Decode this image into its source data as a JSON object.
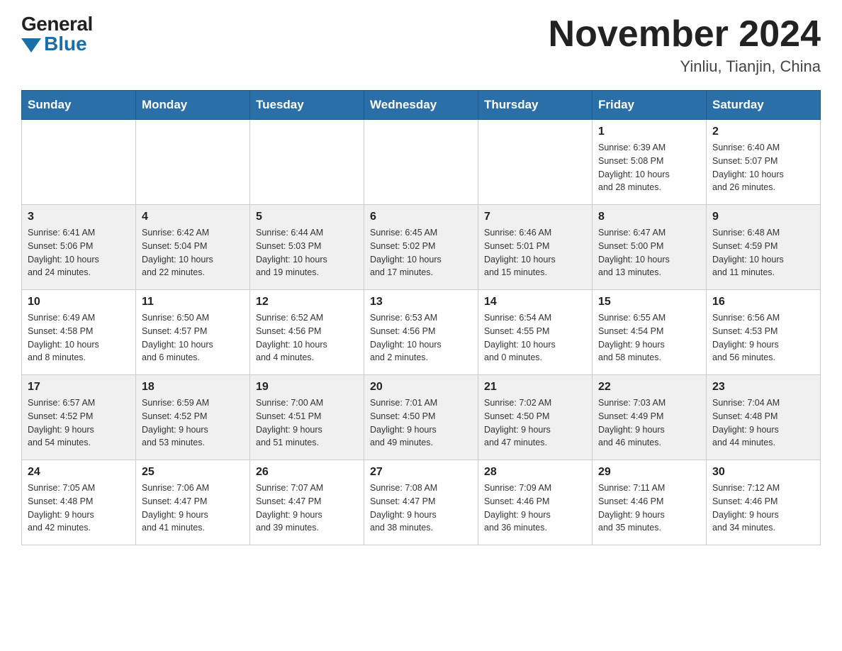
{
  "header": {
    "logo": {
      "general": "General",
      "blue": "Blue"
    },
    "title": "November 2024",
    "location": "Yinliu, Tianjin, China"
  },
  "weekdays": [
    "Sunday",
    "Monday",
    "Tuesday",
    "Wednesday",
    "Thursday",
    "Friday",
    "Saturday"
  ],
  "weeks": [
    [
      {
        "day": "",
        "info": ""
      },
      {
        "day": "",
        "info": ""
      },
      {
        "day": "",
        "info": ""
      },
      {
        "day": "",
        "info": ""
      },
      {
        "day": "",
        "info": ""
      },
      {
        "day": "1",
        "info": "Sunrise: 6:39 AM\nSunset: 5:08 PM\nDaylight: 10 hours\nand 28 minutes."
      },
      {
        "day": "2",
        "info": "Sunrise: 6:40 AM\nSunset: 5:07 PM\nDaylight: 10 hours\nand 26 minutes."
      }
    ],
    [
      {
        "day": "3",
        "info": "Sunrise: 6:41 AM\nSunset: 5:06 PM\nDaylight: 10 hours\nand 24 minutes."
      },
      {
        "day": "4",
        "info": "Sunrise: 6:42 AM\nSunset: 5:04 PM\nDaylight: 10 hours\nand 22 minutes."
      },
      {
        "day": "5",
        "info": "Sunrise: 6:44 AM\nSunset: 5:03 PM\nDaylight: 10 hours\nand 19 minutes."
      },
      {
        "day": "6",
        "info": "Sunrise: 6:45 AM\nSunset: 5:02 PM\nDaylight: 10 hours\nand 17 minutes."
      },
      {
        "day": "7",
        "info": "Sunrise: 6:46 AM\nSunset: 5:01 PM\nDaylight: 10 hours\nand 15 minutes."
      },
      {
        "day": "8",
        "info": "Sunrise: 6:47 AM\nSunset: 5:00 PM\nDaylight: 10 hours\nand 13 minutes."
      },
      {
        "day": "9",
        "info": "Sunrise: 6:48 AM\nSunset: 4:59 PM\nDaylight: 10 hours\nand 11 minutes."
      }
    ],
    [
      {
        "day": "10",
        "info": "Sunrise: 6:49 AM\nSunset: 4:58 PM\nDaylight: 10 hours\nand 8 minutes."
      },
      {
        "day": "11",
        "info": "Sunrise: 6:50 AM\nSunset: 4:57 PM\nDaylight: 10 hours\nand 6 minutes."
      },
      {
        "day": "12",
        "info": "Sunrise: 6:52 AM\nSunset: 4:56 PM\nDaylight: 10 hours\nand 4 minutes."
      },
      {
        "day": "13",
        "info": "Sunrise: 6:53 AM\nSunset: 4:56 PM\nDaylight: 10 hours\nand 2 minutes."
      },
      {
        "day": "14",
        "info": "Sunrise: 6:54 AM\nSunset: 4:55 PM\nDaylight: 10 hours\nand 0 minutes."
      },
      {
        "day": "15",
        "info": "Sunrise: 6:55 AM\nSunset: 4:54 PM\nDaylight: 9 hours\nand 58 minutes."
      },
      {
        "day": "16",
        "info": "Sunrise: 6:56 AM\nSunset: 4:53 PM\nDaylight: 9 hours\nand 56 minutes."
      }
    ],
    [
      {
        "day": "17",
        "info": "Sunrise: 6:57 AM\nSunset: 4:52 PM\nDaylight: 9 hours\nand 54 minutes."
      },
      {
        "day": "18",
        "info": "Sunrise: 6:59 AM\nSunset: 4:52 PM\nDaylight: 9 hours\nand 53 minutes."
      },
      {
        "day": "19",
        "info": "Sunrise: 7:00 AM\nSunset: 4:51 PM\nDaylight: 9 hours\nand 51 minutes."
      },
      {
        "day": "20",
        "info": "Sunrise: 7:01 AM\nSunset: 4:50 PM\nDaylight: 9 hours\nand 49 minutes."
      },
      {
        "day": "21",
        "info": "Sunrise: 7:02 AM\nSunset: 4:50 PM\nDaylight: 9 hours\nand 47 minutes."
      },
      {
        "day": "22",
        "info": "Sunrise: 7:03 AM\nSunset: 4:49 PM\nDaylight: 9 hours\nand 46 minutes."
      },
      {
        "day": "23",
        "info": "Sunrise: 7:04 AM\nSunset: 4:48 PM\nDaylight: 9 hours\nand 44 minutes."
      }
    ],
    [
      {
        "day": "24",
        "info": "Sunrise: 7:05 AM\nSunset: 4:48 PM\nDaylight: 9 hours\nand 42 minutes."
      },
      {
        "day": "25",
        "info": "Sunrise: 7:06 AM\nSunset: 4:47 PM\nDaylight: 9 hours\nand 41 minutes."
      },
      {
        "day": "26",
        "info": "Sunrise: 7:07 AM\nSunset: 4:47 PM\nDaylight: 9 hours\nand 39 minutes."
      },
      {
        "day": "27",
        "info": "Sunrise: 7:08 AM\nSunset: 4:47 PM\nDaylight: 9 hours\nand 38 minutes."
      },
      {
        "day": "28",
        "info": "Sunrise: 7:09 AM\nSunset: 4:46 PM\nDaylight: 9 hours\nand 36 minutes."
      },
      {
        "day": "29",
        "info": "Sunrise: 7:11 AM\nSunset: 4:46 PM\nDaylight: 9 hours\nand 35 minutes."
      },
      {
        "day": "30",
        "info": "Sunrise: 7:12 AM\nSunset: 4:46 PM\nDaylight: 9 hours\nand 34 minutes."
      }
    ]
  ]
}
